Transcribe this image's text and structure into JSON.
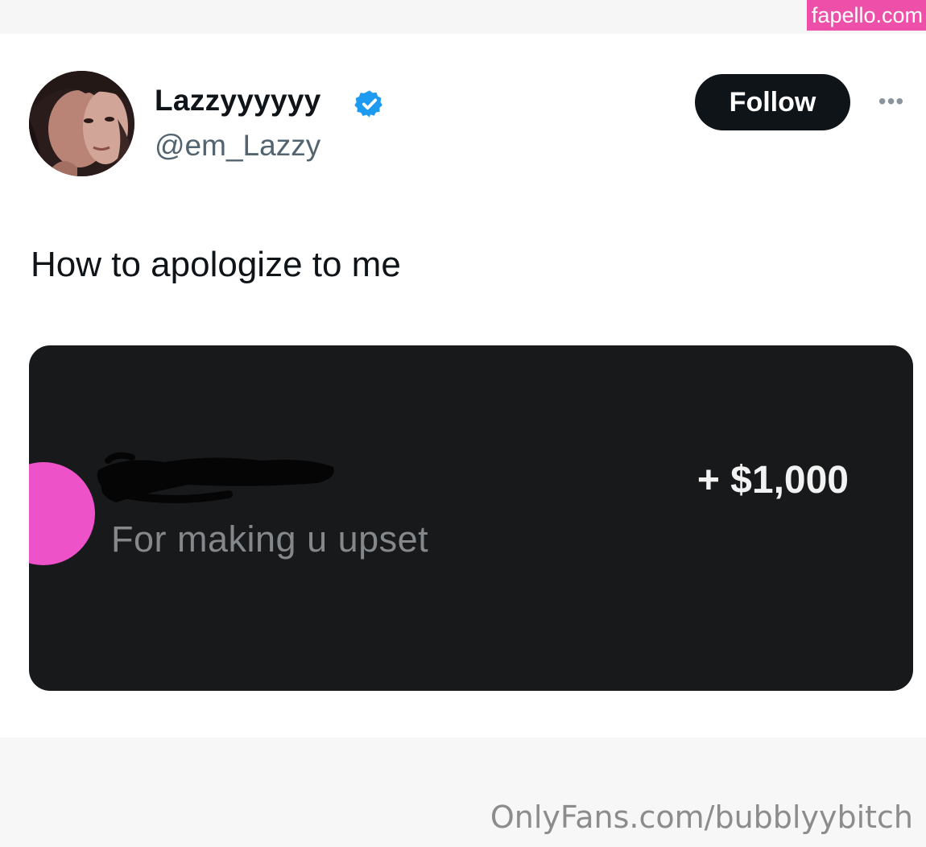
{
  "watermarks": {
    "site": "fapello.com",
    "footer": "OnlyFans.com/bubblyybitch"
  },
  "tweet": {
    "display_name": "Lazzyyyyyy",
    "handle": "@em_Lazzy",
    "verified": true,
    "follow_label": "Follow",
    "more_label": "•••",
    "text": "How to apologize to me",
    "media": {
      "note": "For making u upset",
      "amount": "+ $1,000",
      "name_redacted": true
    }
  },
  "colors": {
    "brand_pink": "#ee4fa8",
    "verified_blue": "#1d9bf0",
    "follow_bg": "#0f1419",
    "media_bg": "#17191b",
    "media_dot": "#ee52c8"
  },
  "icons": [
    "avatar-photo",
    "verified-badge-icon",
    "more-options-icon"
  ]
}
